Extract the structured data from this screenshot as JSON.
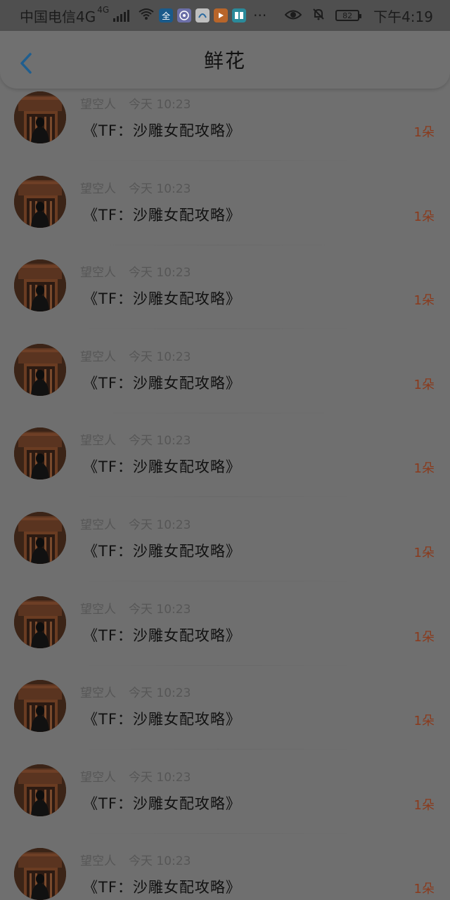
{
  "status_bar": {
    "carrier": "中国电信4G",
    "network_badge": "4G",
    "app_icon_1": "全",
    "more": "···",
    "battery": "82",
    "time": "下午4:19"
  },
  "header": {
    "title": "鲜花"
  },
  "items": [
    {
      "user": "望空人",
      "time": "今天 10:23",
      "title": "《TF：沙雕女配攻略》",
      "count": "1朵"
    },
    {
      "user": "望空人",
      "time": "今天 10:23",
      "title": "《TF：沙雕女配攻略》",
      "count": "1朵"
    },
    {
      "user": "望空人",
      "time": "今天 10:23",
      "title": "《TF：沙雕女配攻略》",
      "count": "1朵"
    },
    {
      "user": "望空人",
      "time": "今天 10:23",
      "title": "《TF：沙雕女配攻略》",
      "count": "1朵"
    },
    {
      "user": "望空人",
      "time": "今天 10:23",
      "title": "《TF：沙雕女配攻略》",
      "count": "1朵"
    },
    {
      "user": "望空人",
      "time": "今天 10:23",
      "title": "《TF：沙雕女配攻略》",
      "count": "1朵"
    },
    {
      "user": "望空人",
      "time": "今天 10:23",
      "title": "《TF：沙雕女配攻略》",
      "count": "1朵"
    },
    {
      "user": "望空人",
      "time": "今天 10:23",
      "title": "《TF：沙雕女配攻略》",
      "count": "1朵"
    },
    {
      "user": "望空人",
      "time": "今天 10:23",
      "title": "《TF：沙雕女配攻略》",
      "count": "1朵"
    },
    {
      "user": "望空人",
      "time": "今天 10:23",
      "title": "《TF：沙雕女配攻略》",
      "count": "1朵"
    }
  ],
  "colors": {
    "accent_back": "#1f5e8f",
    "count_text": "#8a3a1c"
  }
}
